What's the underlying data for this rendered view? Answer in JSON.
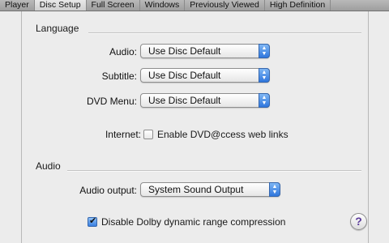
{
  "tabs": [
    "Player",
    "Disc Setup",
    "Full Screen",
    "Windows",
    "Previously Viewed",
    "High Definition"
  ],
  "language_section": {
    "title": "Language",
    "audio": {
      "label": "Audio:",
      "value": "Use Disc Default"
    },
    "subtitle": {
      "label": "Subtitle:",
      "value": "Use Disc Default"
    },
    "dvd_menu": {
      "label": "DVD Menu:",
      "value": "Use Disc Default"
    },
    "internet": {
      "label": "Internet:",
      "checkbox_label": "Enable DVD@ccess web links",
      "checked": false
    }
  },
  "audio_section": {
    "title": "Audio",
    "output": {
      "label": "Audio output:",
      "value": "System Sound Output"
    },
    "dolby": {
      "checkbox_label": "Disable Dolby dynamic range compression",
      "checked": true
    }
  },
  "help": {
    "glyph": "?"
  }
}
